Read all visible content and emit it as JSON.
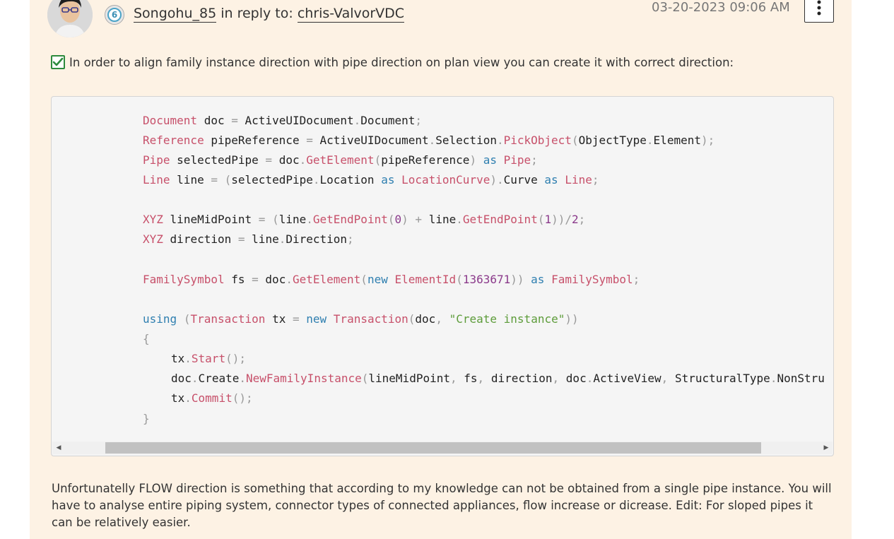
{
  "post": {
    "rank": "6",
    "author": "Songohu_85",
    "reply_prefix": "in reply to:",
    "reply_to": "chris-ValvorVDC",
    "timestamp": "03-20-2023 09:06 AM",
    "intro": "In order to align family instance direction with pipe direction on plan view you can create it with correct direction:",
    "paragraph": " Unfortunatelly FLOW direction is something that according to my knowledge can not be obtained from a single pipe instance. You will have to analyse entire piping system, connector types of connected appliances, flow increase or dicrease. Edit: For sloped pipes it can be relatively easier."
  },
  "code": {
    "lines": [
      {
        "indent": 0,
        "tokens": [
          [
            "type",
            "Document"
          ],
          [
            "sp",
            " "
          ],
          [
            "var",
            "doc"
          ],
          [
            "sp",
            " "
          ],
          [
            "op",
            "="
          ],
          [
            "sp",
            " "
          ],
          [
            "var",
            "ActiveUIDocument"
          ],
          [
            "op",
            "."
          ],
          [
            "var",
            "Document"
          ],
          [
            "op",
            ";"
          ]
        ]
      },
      {
        "indent": 0,
        "tokens": [
          [
            "type",
            "Reference"
          ],
          [
            "sp",
            " "
          ],
          [
            "var",
            "pipeReference"
          ],
          [
            "sp",
            " "
          ],
          [
            "op",
            "="
          ],
          [
            "sp",
            " "
          ],
          [
            "var",
            "ActiveUIDocument"
          ],
          [
            "op",
            "."
          ],
          [
            "var",
            "Selection"
          ],
          [
            "op",
            "."
          ],
          [
            "type",
            "PickObject"
          ],
          [
            "op",
            "("
          ],
          [
            "var",
            "ObjectType"
          ],
          [
            "op",
            "."
          ],
          [
            "var",
            "Element"
          ],
          [
            "op",
            ");"
          ]
        ]
      },
      {
        "indent": 0,
        "tokens": [
          [
            "type",
            "Pipe"
          ],
          [
            "sp",
            " "
          ],
          [
            "var",
            "selectedPipe"
          ],
          [
            "sp",
            " "
          ],
          [
            "op",
            "="
          ],
          [
            "sp",
            " "
          ],
          [
            "var",
            "doc"
          ],
          [
            "op",
            "."
          ],
          [
            "type",
            "GetElement"
          ],
          [
            "op",
            "("
          ],
          [
            "var",
            "pipeReference"
          ],
          [
            "op",
            ")"
          ],
          [
            "sp",
            " "
          ],
          [
            "kw",
            "as"
          ],
          [
            "sp",
            " "
          ],
          [
            "type",
            "Pipe"
          ],
          [
            "op",
            ";"
          ]
        ]
      },
      {
        "indent": 0,
        "tokens": [
          [
            "type",
            "Line"
          ],
          [
            "sp",
            " "
          ],
          [
            "var",
            "line"
          ],
          [
            "sp",
            " "
          ],
          [
            "op",
            "="
          ],
          [
            "sp",
            " "
          ],
          [
            "op",
            "("
          ],
          [
            "var",
            "selectedPipe"
          ],
          [
            "op",
            "."
          ],
          [
            "var",
            "Location"
          ],
          [
            "sp",
            " "
          ],
          [
            "kw",
            "as"
          ],
          [
            "sp",
            " "
          ],
          [
            "type",
            "LocationCurve"
          ],
          [
            "op",
            ")."
          ],
          [
            "var",
            "Curve"
          ],
          [
            "sp",
            " "
          ],
          [
            "kw",
            "as"
          ],
          [
            "sp",
            " "
          ],
          [
            "type",
            "Line"
          ],
          [
            "op",
            ";"
          ]
        ]
      },
      {
        "indent": 0,
        "tokens": []
      },
      {
        "indent": 0,
        "tokens": [
          [
            "type",
            "XYZ"
          ],
          [
            "sp",
            " "
          ],
          [
            "var",
            "lineMidPoint"
          ],
          [
            "sp",
            " "
          ],
          [
            "op",
            "="
          ],
          [
            "sp",
            " "
          ],
          [
            "op",
            "("
          ],
          [
            "var",
            "line"
          ],
          [
            "op",
            "."
          ],
          [
            "type",
            "GetEndPoint"
          ],
          [
            "op",
            "("
          ],
          [
            "num",
            "0"
          ],
          [
            "op",
            ")"
          ],
          [
            "sp",
            " "
          ],
          [
            "op",
            "+"
          ],
          [
            "sp",
            " "
          ],
          [
            "var",
            "line"
          ],
          [
            "op",
            "."
          ],
          [
            "type",
            "GetEndPoint"
          ],
          [
            "op",
            "("
          ],
          [
            "num",
            "1"
          ],
          [
            "op",
            "))/"
          ],
          [
            "num",
            "2"
          ],
          [
            "op",
            ";"
          ]
        ]
      },
      {
        "indent": 0,
        "tokens": [
          [
            "type",
            "XYZ"
          ],
          [
            "sp",
            " "
          ],
          [
            "var",
            "direction"
          ],
          [
            "sp",
            " "
          ],
          [
            "op",
            "="
          ],
          [
            "sp",
            " "
          ],
          [
            "var",
            "line"
          ],
          [
            "op",
            "."
          ],
          [
            "var",
            "Direction"
          ],
          [
            "op",
            ";"
          ]
        ]
      },
      {
        "indent": 0,
        "tokens": []
      },
      {
        "indent": 0,
        "tokens": [
          [
            "type",
            "FamilySymbol"
          ],
          [
            "sp",
            " "
          ],
          [
            "var",
            "fs"
          ],
          [
            "sp",
            " "
          ],
          [
            "op",
            "="
          ],
          [
            "sp",
            " "
          ],
          [
            "var",
            "doc"
          ],
          [
            "op",
            "."
          ],
          [
            "type",
            "GetElement"
          ],
          [
            "op",
            "("
          ],
          [
            "kw",
            "new"
          ],
          [
            "sp",
            " "
          ],
          [
            "type",
            "ElementId"
          ],
          [
            "op",
            "("
          ],
          [
            "num",
            "1363671"
          ],
          [
            "op",
            "))"
          ],
          [
            "sp",
            " "
          ],
          [
            "kw",
            "as"
          ],
          [
            "sp",
            " "
          ],
          [
            "type",
            "FamilySymbol"
          ],
          [
            "op",
            ";"
          ]
        ]
      },
      {
        "indent": 0,
        "tokens": []
      },
      {
        "indent": 0,
        "tokens": [
          [
            "kw",
            "using"
          ],
          [
            "sp",
            " "
          ],
          [
            "op",
            "("
          ],
          [
            "type",
            "Transaction"
          ],
          [
            "sp",
            " "
          ],
          [
            "var",
            "tx"
          ],
          [
            "sp",
            " "
          ],
          [
            "op",
            "="
          ],
          [
            "sp",
            " "
          ],
          [
            "kw",
            "new"
          ],
          [
            "sp",
            " "
          ],
          [
            "type",
            "Transaction"
          ],
          [
            "op",
            "("
          ],
          [
            "var",
            "doc"
          ],
          [
            "op",
            ","
          ],
          [
            "sp",
            " "
          ],
          [
            "str",
            "\"Create instance\""
          ],
          [
            "op",
            "))"
          ]
        ]
      },
      {
        "indent": 0,
        "tokens": [
          [
            "op",
            "{"
          ]
        ]
      },
      {
        "indent": 1,
        "tokens": [
          [
            "var",
            "tx"
          ],
          [
            "op",
            "."
          ],
          [
            "type",
            "Start"
          ],
          [
            "op",
            "();"
          ]
        ]
      },
      {
        "indent": 1,
        "tokens": [
          [
            "var",
            "doc"
          ],
          [
            "op",
            "."
          ],
          [
            "var",
            "Create"
          ],
          [
            "op",
            "."
          ],
          [
            "type",
            "NewFamilyInstance"
          ],
          [
            "op",
            "("
          ],
          [
            "var",
            "lineMidPoint"
          ],
          [
            "op",
            ","
          ],
          [
            "sp",
            " "
          ],
          [
            "var",
            "fs"
          ],
          [
            "op",
            ","
          ],
          [
            "sp",
            " "
          ],
          [
            "var",
            "direction"
          ],
          [
            "op",
            ","
          ],
          [
            "sp",
            " "
          ],
          [
            "var",
            "doc"
          ],
          [
            "op",
            "."
          ],
          [
            "var",
            "ActiveView"
          ],
          [
            "op",
            ","
          ],
          [
            "sp",
            " "
          ],
          [
            "var",
            "StructuralType"
          ],
          [
            "op",
            "."
          ],
          [
            "var",
            "NonStru"
          ]
        ]
      },
      {
        "indent": 1,
        "tokens": [
          [
            "var",
            "tx"
          ],
          [
            "op",
            "."
          ],
          [
            "type",
            "Commit"
          ],
          [
            "op",
            "();"
          ]
        ]
      },
      {
        "indent": 0,
        "tokens": [
          [
            "op",
            "}"
          ]
        ]
      }
    ]
  },
  "scrollbar": {
    "left_arrow": "◀",
    "right_arrow": "▶"
  },
  "colors": {
    "background": "#fdf2e4",
    "check": "#2e8b3e",
    "type": "#c7506a",
    "keyword": "#2f7fb0",
    "string": "#5d9c3a"
  }
}
